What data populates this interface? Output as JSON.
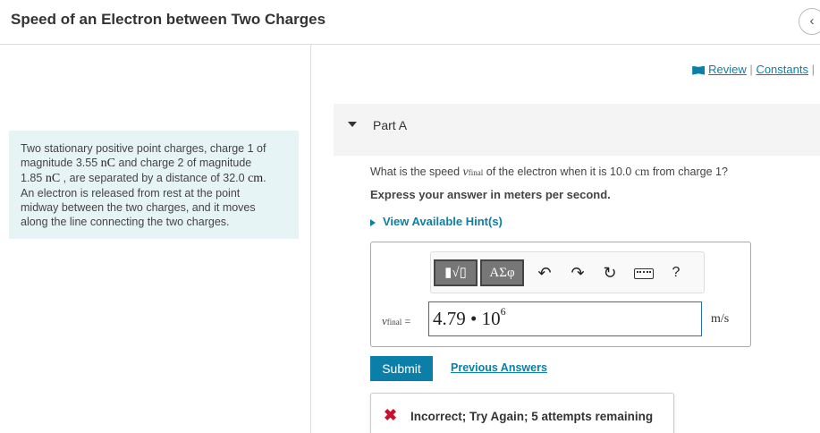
{
  "header": {
    "title": "Speed of an Electron between Two Charges",
    "collapse_icon": "‹"
  },
  "problem": {
    "l1": "Two stationary positive point charges, charge 1 of",
    "l2a": "magnitude 3.55",
    "l2u": "nC",
    "l2b": "and charge 2 of magnitude",
    "l3a": "1.85",
    "l3u": "nC",
    "l3b": ", are separated by a distance of 32.0",
    "l3c": "cm",
    "l4": "An electron is released from rest at the point",
    "l5": "midway between the two charges, and it moves",
    "l6": "along the line connecting the two charges."
  },
  "links": {
    "review": "Review",
    "sep": "|",
    "constants": "Constants",
    "tail": "|"
  },
  "part": {
    "label": "Part A"
  },
  "question": {
    "before": "What is the speed",
    "var": "v",
    "var_sub": "final",
    "middle": "of the electron when it is 10.0",
    "unit": "cm",
    "after": "from charge 1?",
    "express": "Express your answer in meters per second.",
    "hints": "View Available Hint(s)"
  },
  "toolbar": {
    "templates_label": "▮√▯",
    "greek_label": "ΑΣφ",
    "undo_icon": "↶",
    "redo_icon": "↷",
    "reset_icon": "↻",
    "help_label": "?"
  },
  "answer": {
    "var": "v",
    "var_sub": "final",
    "eq": "=",
    "value": "4.79 • 10",
    "exponent": "6",
    "unit": "m/s"
  },
  "actions": {
    "submit": "Submit",
    "previous": "Previous Answers"
  },
  "feedback": {
    "icon": "✖",
    "text": "Incorrect; Try Again; 5 attempts remaining"
  }
}
